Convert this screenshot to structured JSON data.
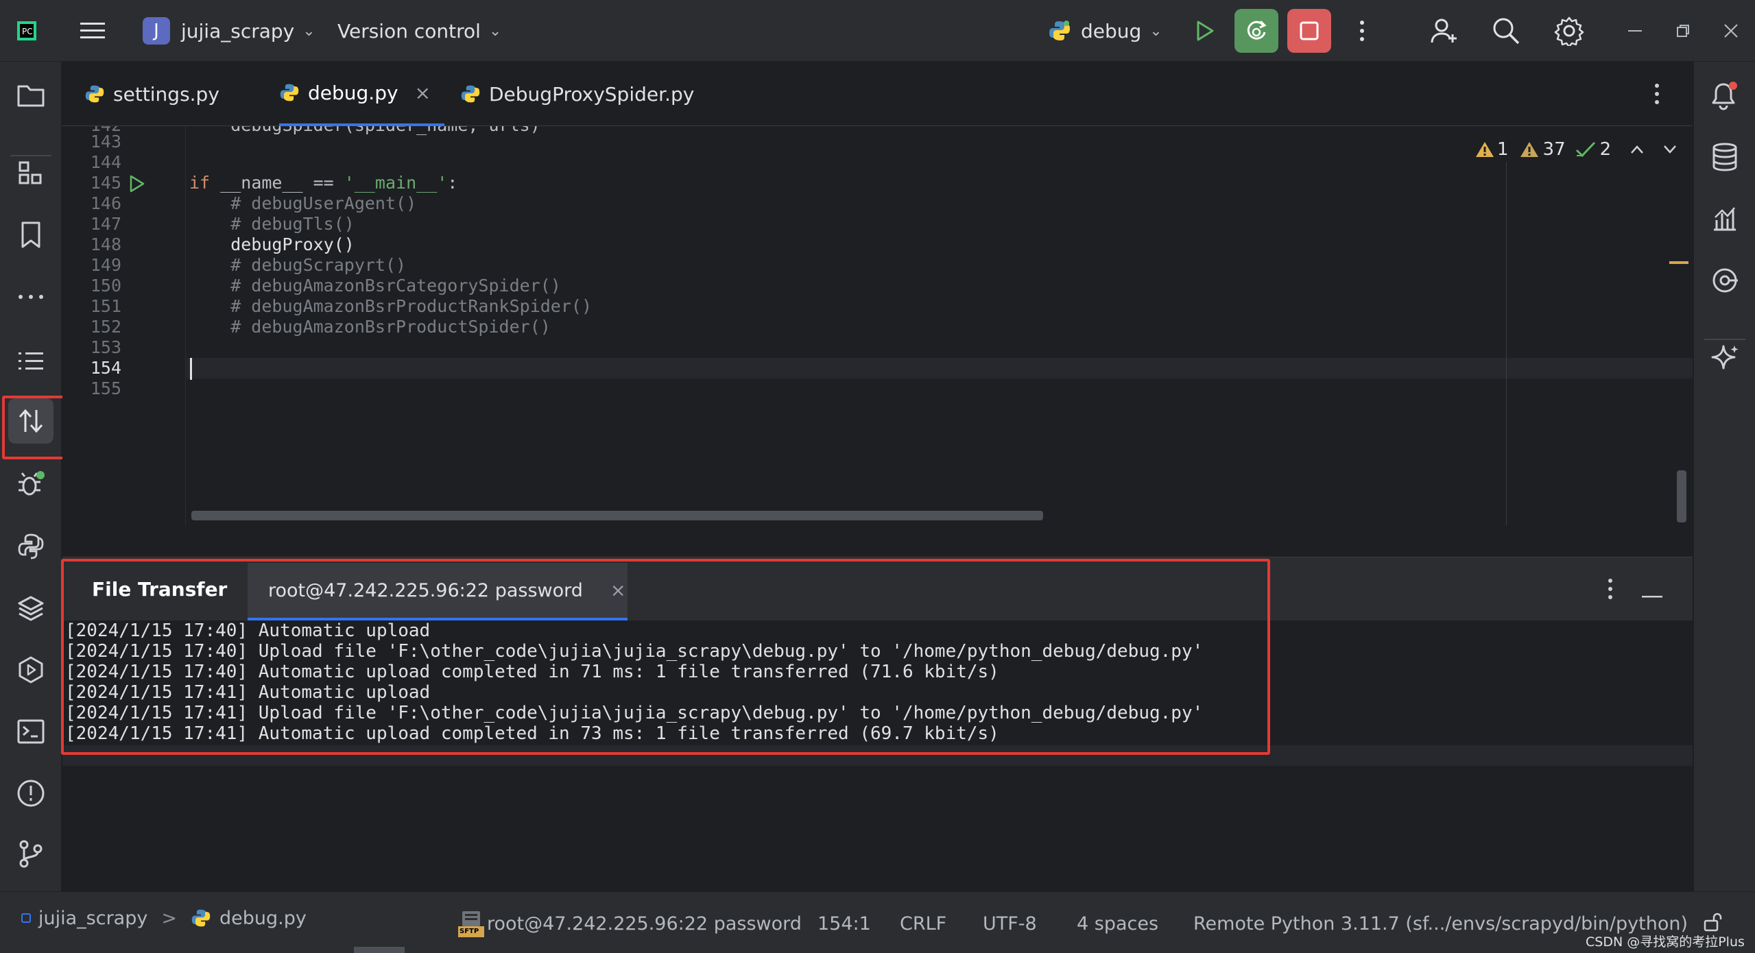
{
  "titlebar": {
    "project_initial": "J",
    "project_name": "jujia_scrapy",
    "vcs_label": "Version control",
    "run_config": "debug"
  },
  "tabs": [
    {
      "label": "settings.py"
    },
    {
      "label": "debug.py",
      "close": "×"
    },
    {
      "label": "DebugProxySpider.py"
    }
  ],
  "inspections": {
    "errors": "1",
    "warnings": "37",
    "ok": "2"
  },
  "editor": {
    "lines": [
      {
        "num": "143",
        "text": ""
      },
      {
        "num": "144",
        "text": ""
      },
      {
        "num": "145",
        "text": ""
      },
      {
        "num": "146",
        "text": "    # debugUserAgent()"
      },
      {
        "num": "147",
        "text": "    # debugTls()"
      },
      {
        "num": "148",
        "text": "    debugProxy()"
      },
      {
        "num": "149",
        "text": "    # debugScrapyrt()"
      },
      {
        "num": "150",
        "text": "    # debugAmazonBsrCategorySpider()"
      },
      {
        "num": "151",
        "text": "    # debugAmazonBsrProductRankSpider()"
      },
      {
        "num": "152",
        "text": "    # debugAmazonBsrProductSpider()"
      },
      {
        "num": "153",
        "text": ""
      },
      {
        "num": "154",
        "text": ""
      },
      {
        "num": "155",
        "text": ""
      }
    ],
    "main_kw": "if",
    "main_mid": " __name__ == ",
    "main_str": "'__main__'",
    "main_end": ":",
    "partial_top": "    debugSpider(spider_name, urls)"
  },
  "panel": {
    "tab_title": "File Transfer",
    "session_tab": "root@47.242.225.96:22 password",
    "session_close": "×",
    "log": [
      "[2024/1/15 17:40] Automatic upload",
      "[2024/1/15 17:40] Upload file 'F:\\other_code\\jujia\\jujia_scrapy\\debug.py' to '/home/python_debug/debug.py'",
      "[2024/1/15 17:40] Automatic upload completed in 71 ms: 1 file transferred (71.6 kbit/s)",
      "[2024/1/15 17:41] Automatic upload",
      "[2024/1/15 17:41] Upload file 'F:\\other_code\\jujia\\jujia_scrapy\\debug.py' to '/home/python_debug/debug.py'",
      "[2024/1/15 17:41] Automatic upload completed in 73 ms: 1 file transferred (69.7 kbit/s)"
    ]
  },
  "statusbar": {
    "breadcrumb_project": "jujia_scrapy",
    "breadcrumb_sep": ">",
    "breadcrumb_file": "debug.py",
    "sftp_label": "SFTP",
    "connection": "root@47.242.225.96:22 password",
    "position": "154:1",
    "line_sep": "CRLF",
    "encoding": "UTF-8",
    "indent": "4 spaces",
    "interpreter": "Remote Python 3.11.7 (sf.../envs/scrapyd/bin/python)",
    "watermark": "CSDN @寻找窝的考拉Plus"
  },
  "colors": {
    "accent": "#3574f0",
    "highlight_box": "#e53935",
    "run_green": "#57965c",
    "stop_red": "#db5c5c"
  }
}
